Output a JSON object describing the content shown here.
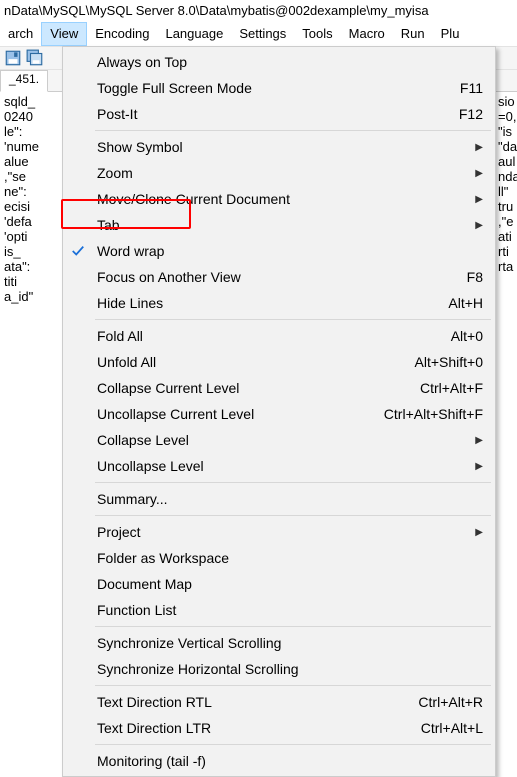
{
  "window": {
    "title_fragment": "nData\\MySQL\\MySQL Server 8.0\\Data\\mybatis@002dexample\\my_myisa"
  },
  "menubar": {
    "items": [
      "arch",
      "View",
      "Encoding",
      "Language",
      "Settings",
      "Tools",
      "Macro",
      "Run",
      "Plu"
    ],
    "active_index": 1
  },
  "tab": {
    "label": "_451."
  },
  "editor": {
    "lines": [
      "sqld_",
      "0240",
      "le\":",
      "'nume",
      "alue",
      ",\"se",
      "ne\":",
      "ecisi",
      "'defa",
      "'opti",
      "is_",
      "ata\":",
      "titi",
      "a_id\""
    ],
    "right_fragment": [
      "sio",
      "=0,",
      "\"is",
      "\"da",
      "aul",
      "nda",
      "ll\"",
      "tru",
      ",\"e",
      "ati",
      "rti",
      "rta"
    ]
  },
  "view_menu": {
    "groups": [
      [
        {
          "label": "Always on Top",
          "kb": "",
          "sub": false,
          "check": false
        },
        {
          "label": "Toggle Full Screen Mode",
          "kb": "F11",
          "sub": false,
          "check": false
        },
        {
          "label": "Post-It",
          "kb": "F12",
          "sub": false,
          "check": false
        }
      ],
      [
        {
          "label": "Show Symbol",
          "kb": "",
          "sub": true,
          "check": false
        },
        {
          "label": "Zoom",
          "kb": "",
          "sub": true,
          "check": false
        },
        {
          "label": "Move/Clone Current Document",
          "kb": "",
          "sub": true,
          "check": false
        },
        {
          "label": "Tab",
          "kb": "",
          "sub": true,
          "check": false
        },
        {
          "label": "Word wrap",
          "kb": "",
          "sub": false,
          "check": true
        },
        {
          "label": "Focus on Another View",
          "kb": "F8",
          "sub": false,
          "check": false
        },
        {
          "label": "Hide Lines",
          "kb": "Alt+H",
          "sub": false,
          "check": false
        }
      ],
      [
        {
          "label": "Fold All",
          "kb": "Alt+0",
          "sub": false,
          "check": false
        },
        {
          "label": "Unfold All",
          "kb": "Alt+Shift+0",
          "sub": false,
          "check": false
        },
        {
          "label": "Collapse Current Level",
          "kb": "Ctrl+Alt+F",
          "sub": false,
          "check": false
        },
        {
          "label": "Uncollapse Current Level",
          "kb": "Ctrl+Alt+Shift+F",
          "sub": false,
          "check": false
        },
        {
          "label": "Collapse Level",
          "kb": "",
          "sub": true,
          "check": false
        },
        {
          "label": "Uncollapse Level",
          "kb": "",
          "sub": true,
          "check": false
        }
      ],
      [
        {
          "label": "Summary...",
          "kb": "",
          "sub": false,
          "check": false
        }
      ],
      [
        {
          "label": "Project",
          "kb": "",
          "sub": true,
          "check": false
        },
        {
          "label": "Folder as Workspace",
          "kb": "",
          "sub": false,
          "check": false
        },
        {
          "label": "Document Map",
          "kb": "",
          "sub": false,
          "check": false
        },
        {
          "label": "Function List",
          "kb": "",
          "sub": false,
          "check": false
        }
      ],
      [
        {
          "label": "Synchronize Vertical Scrolling",
          "kb": "",
          "sub": false,
          "check": false
        },
        {
          "label": "Synchronize Horizontal Scrolling",
          "kb": "",
          "sub": false,
          "check": false
        }
      ],
      [
        {
          "label": "Text Direction RTL",
          "kb": "Ctrl+Alt+R",
          "sub": false,
          "check": false
        },
        {
          "label": "Text Direction LTR",
          "kb": "Ctrl+Alt+L",
          "sub": false,
          "check": false
        }
      ],
      [
        {
          "label": "Monitoring (tail -f)",
          "kb": "",
          "sub": false,
          "check": false
        }
      ]
    ]
  }
}
